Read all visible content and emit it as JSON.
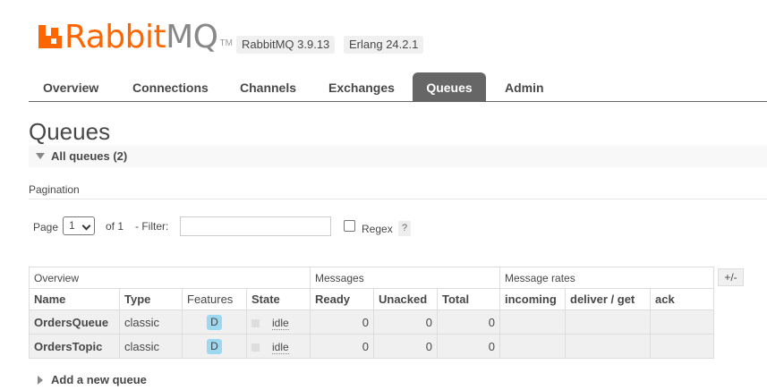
{
  "header": {
    "logo_rabbit": "Rabbit",
    "logo_mq": "MQ",
    "logo_tm": "TM",
    "version": "RabbitMQ 3.9.13",
    "erlang": "Erlang 24.2.1"
  },
  "nav": {
    "tabs": [
      "Overview",
      "Connections",
      "Channels",
      "Exchanges",
      "Queues",
      "Admin"
    ],
    "active": "Queues"
  },
  "page_title": "Queues",
  "section_title": "All queues (2)",
  "pagination": {
    "label": "Pagination",
    "page_label": "Page",
    "page_value": "1",
    "of_label": "of 1",
    "filter_label": "- Filter:",
    "filter_value": "",
    "regex_label": "Regex",
    "regex_checked": false,
    "help": "?"
  },
  "table": {
    "groups": [
      "Overview",
      "Messages",
      "Message rates"
    ],
    "columns": [
      "Name",
      "Type",
      "Features",
      "State",
      "Ready",
      "Unacked",
      "Total",
      "incoming",
      "deliver / get",
      "ack"
    ],
    "rows": [
      {
        "name": "OrdersQueue",
        "type": "classic",
        "feature": "D",
        "state": "idle",
        "ready": "0",
        "unacked": "0",
        "total": "0",
        "incoming": "",
        "deliver_get": "",
        "ack": ""
      },
      {
        "name": "OrdersTopic",
        "type": "classic",
        "feature": "D",
        "state": "idle",
        "ready": "0",
        "unacked": "0",
        "total": "0",
        "incoming": "",
        "deliver_get": "",
        "ack": ""
      }
    ],
    "columns_toggle": "+/-"
  },
  "add_queue_label": "Add a new queue",
  "colors": {
    "brand": "#ff6600",
    "tab_active": "#666666",
    "feature_badge": "#9cd8f0"
  }
}
